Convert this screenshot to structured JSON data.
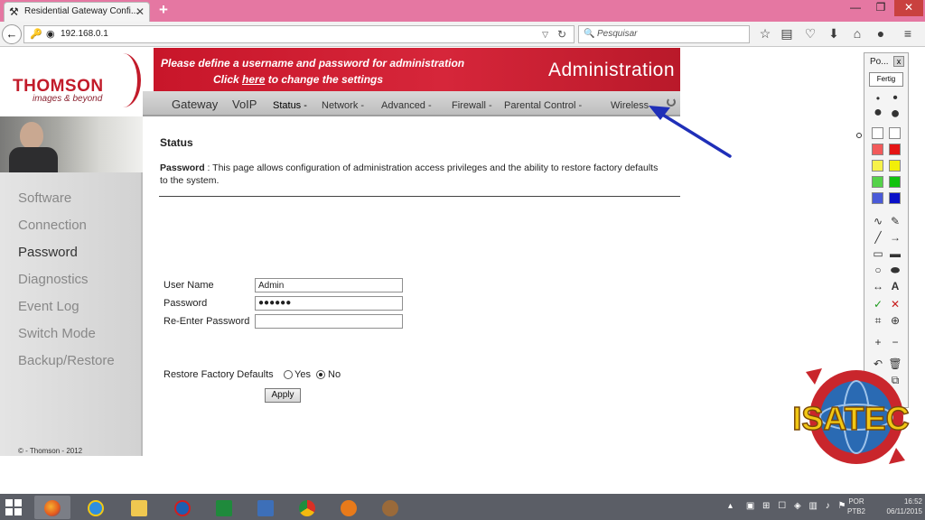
{
  "browser": {
    "tab_title": "Residential Gateway Confi...",
    "tab_close": "✕",
    "new_tab": "+",
    "window_controls": {
      "minimize": "—",
      "maximize": "❐",
      "close": "✕"
    },
    "url": "192.168.0.1",
    "search_placeholder": "Pesquisar",
    "toolbar_icons": [
      "star-icon",
      "reader-icon",
      "pocket-icon",
      "download-icon",
      "home-icon",
      "chat-icon",
      "menu-icon"
    ]
  },
  "router": {
    "brand": "THOMSON",
    "tagline": "images & beyond",
    "banner_line1": "Please define a username and password for administration",
    "banner_line2_pre": "Click ",
    "banner_link": "here",
    "banner_line2_post": " to change the settings",
    "banner_title": "Administration",
    "top_tabs": [
      "Gateway",
      "VoIP"
    ],
    "sub_tabs": [
      "Status -",
      "Network -",
      "Advanced -",
      "Firewall -",
      "Parental Control -",
      "Wireless"
    ],
    "active_sub_tab": "Status -",
    "sidebar": [
      "Software",
      "Connection",
      "Password",
      "Diagnostics",
      "Event Log",
      "Switch Mode",
      "Backup/Restore"
    ],
    "active_sidebar": "Password",
    "copyright": "© - Thomson - 2012"
  },
  "content": {
    "title": "Status",
    "desc_label": "Password",
    "desc_text": "  :  This page allows configuration of administration access privileges and the ability to restore factory defaults to the system.",
    "fields": {
      "username_label": "User Name",
      "username_value": "Admin",
      "password_label": "Password",
      "password_value": "●●●●●●",
      "reenter_label": "Re-Enter Password",
      "reenter_value": ""
    },
    "restore_label": "Restore Factory Defaults",
    "restore_yes": "Yes",
    "restore_no": "No",
    "restore_selected": "No",
    "apply_label": "Apply"
  },
  "tool_panel": {
    "title": "Po...",
    "close": "x",
    "done_button": "Fertig",
    "colors": [
      "#ffffff",
      "#ffffff",
      "#f25a5a",
      "#e41414",
      "#f7f24a",
      "#f2ef0a",
      "#55d24a",
      "#12c20e",
      "#4a5ad8",
      "#0a10c8",
      "#ffffff",
      "#000000"
    ],
    "icons": [
      "pen-icon",
      "eraser-icon",
      "line-icon",
      "arrow-icon",
      "rectangle-icon",
      "filled-rectangle-icon",
      "ellipse-icon",
      "filled-ellipse-icon",
      "double-arrow-icon",
      "text-icon",
      "check-icon",
      "cross-icon",
      "crop-icon",
      "zoom-icon",
      "zoom-in-icon",
      "zoom-out-icon",
      "undo-icon",
      "trash-icon",
      "copy-icon"
    ],
    "text_tool_glyph": "A"
  },
  "watermark": {
    "text": "ISATEC"
  },
  "taskbar": {
    "apps": [
      "firefox",
      "internet-explorer",
      "file-explorer",
      "ccleaner",
      "excel",
      "remote-desktop",
      "chrome",
      "avast",
      "gimp"
    ],
    "lang_line1": "POR",
    "lang_line2": "PTB2",
    "time": "16:52",
    "date": "06/11/2015"
  },
  "colors": {
    "tabbar": "#e577a2",
    "banner": "#c8162a",
    "thomson_red": "#c21b2a",
    "annotation_arrow": "#1f2fb8",
    "taskbar": "#5b5e66"
  }
}
